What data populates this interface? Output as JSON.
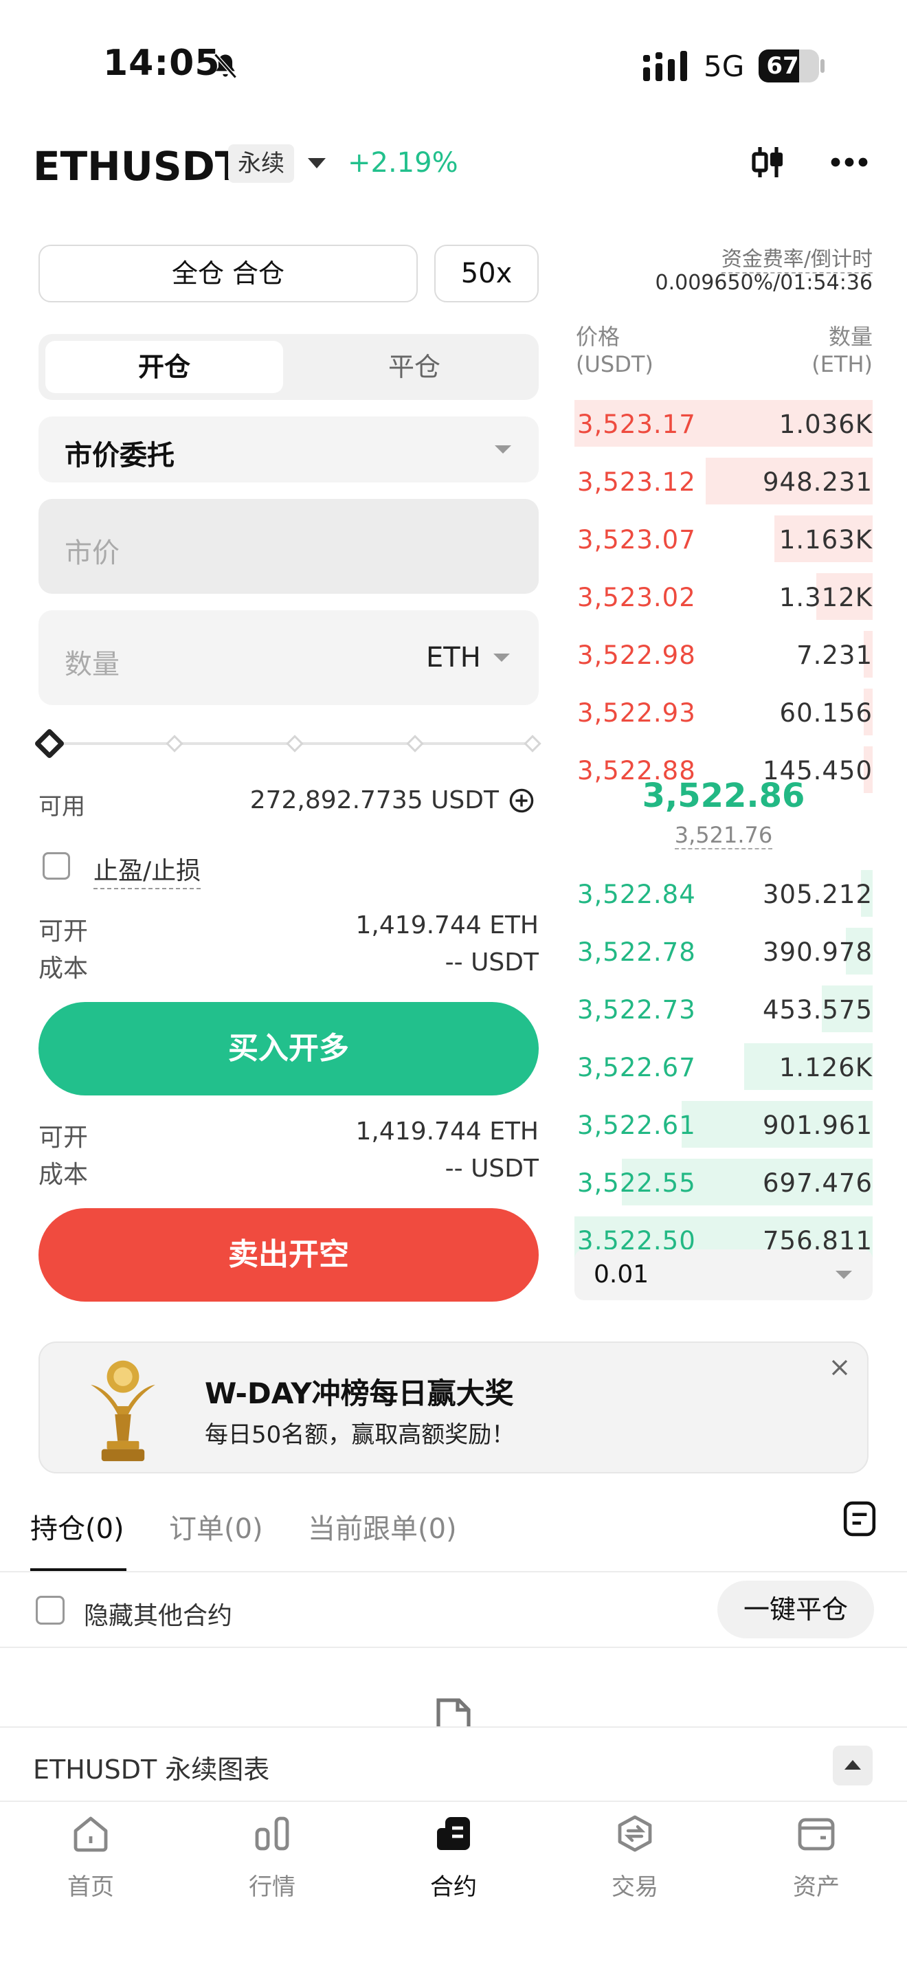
{
  "status_bar": {
    "time": "14:05",
    "network": "5G",
    "battery": "67",
    "battery_level_pct": 67
  },
  "header": {
    "symbol": "ETHUSDT",
    "contract_type": "永续",
    "change": "+2.19%"
  },
  "form": {
    "margin_mode": "全仓 合仓",
    "leverage": "50x",
    "tab_open": "开仓",
    "tab_close": "平仓",
    "order_type": "市价委托",
    "price_placeholder": "市价",
    "qty_placeholder": "数量",
    "qty_unit": "ETH",
    "slider_pct": 0,
    "available_label": "可用",
    "available_value": "272,892.7735 USDT",
    "tpsl_label": "止盈/止损",
    "buy": {
      "can_open_label": "可开",
      "can_open_value": "1,419.744 ETH",
      "cost_label": "成本",
      "cost_value": "-- USDT",
      "button": "买入开多"
    },
    "sell": {
      "can_open_label": "可开",
      "can_open_value": "1,419.744 ETH",
      "cost_label": "成本",
      "cost_value": "-- USDT",
      "button": "卖出开空"
    }
  },
  "orderbook": {
    "funding_label": "资金费率/倒计时",
    "funding_value": "0.009650%/01:54:36",
    "price_header": "价格",
    "price_unit": "(USDT)",
    "qty_header": "数量",
    "qty_unit": "(ETH)",
    "asks": [
      {
        "price": "3,523.17",
        "qty": "1.036K",
        "depth": 1.0
      },
      {
        "price": "3,523.12",
        "qty": "948.231",
        "depth": 0.56
      },
      {
        "price": "3,523.07",
        "qty": "1.163K",
        "depth": 0.33
      },
      {
        "price": "3,523.02",
        "qty": "1.312K",
        "depth": 0.19
      },
      {
        "price": "3,522.98",
        "qty": "7.231",
        "depth": 0.03
      },
      {
        "price": "3,522.93",
        "qty": "60.156",
        "depth": 0.03
      },
      {
        "price": "3,522.88",
        "qty": "145.450",
        "depth": 0.03
      }
    ],
    "last_price": "3,522.86",
    "mark_price": "3,521.76",
    "bids": [
      {
        "price": "3,522.84",
        "qty": "305.212",
        "depth": 0.04
      },
      {
        "price": "3,522.78",
        "qty": "390.978",
        "depth": 0.09
      },
      {
        "price": "3,522.73",
        "qty": "453.575",
        "depth": 0.17
      },
      {
        "price": "3,522.67",
        "qty": "1.126K",
        "depth": 0.43
      },
      {
        "price": "3,522.61",
        "qty": "901.961",
        "depth": 0.64
      },
      {
        "price": "3,522.55",
        "qty": "697.476",
        "depth": 0.84
      },
      {
        "price": "3,522.50",
        "qty": "756.811",
        "depth": 1.0
      }
    ],
    "depth_step": "0.01"
  },
  "banner": {
    "title": "W-DAY冲榜每日赢大奖",
    "subtitle": "每日50名额，赢取高额奖励！"
  },
  "positions": {
    "tabs": [
      "持仓(0)",
      "订单(0)",
      "当前跟单(0)"
    ],
    "hide_others": "隐藏其他合约",
    "close_all": "一键平仓"
  },
  "chart_bar": {
    "label": "ETHUSDT 永续图表"
  },
  "nav": [
    {
      "label": "首页",
      "icon": "home-icon"
    },
    {
      "label": "行情",
      "icon": "market-icon"
    },
    {
      "label": "合约",
      "icon": "futures-icon"
    },
    {
      "label": "交易",
      "icon": "trade-icon"
    },
    {
      "label": "资产",
      "icon": "wallet-icon"
    }
  ]
}
